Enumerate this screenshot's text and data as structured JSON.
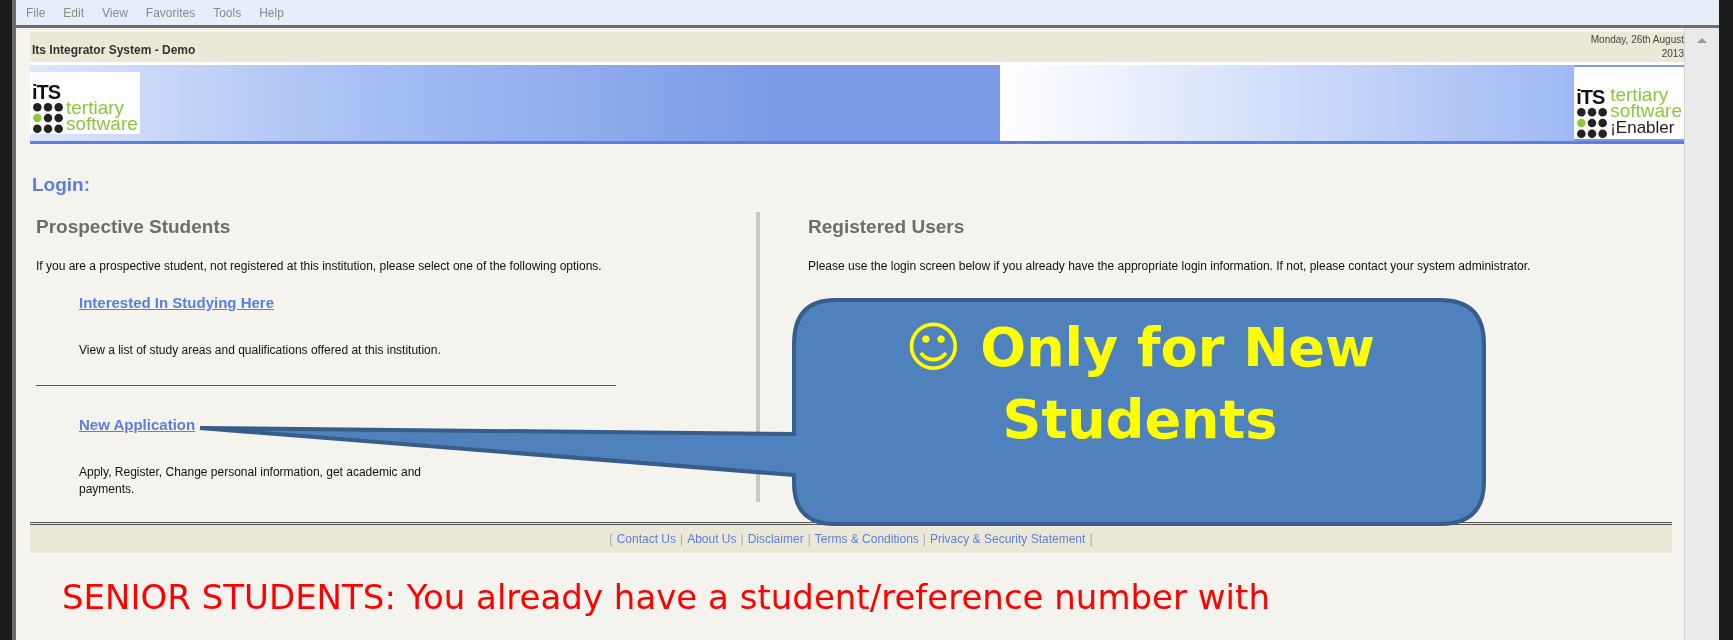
{
  "menu": [
    "File",
    "Edit",
    "View",
    "Favorites",
    "Tools",
    "Help"
  ],
  "header": {
    "title": "Its Integrator System - Demo",
    "date": "Monday, 26th August 2013"
  },
  "banner": {
    "left_logo": {
      "mark": "iTS",
      "lines": [
        "tertiary",
        "software"
      ]
    },
    "right_logo": {
      "mark": "iTS",
      "lines": [
        "tertiary",
        "software"
      ],
      "tagline": "¡Enabler"
    }
  },
  "page_title": "Login:",
  "prospective": {
    "heading": "Prospective Students",
    "intro": "If you are a prospective student, not registered at this institution, please select one of the following options.",
    "options": [
      {
        "link": "Interested In Studying Here",
        "description": "View a list of study areas and qualifications offered at this institution."
      },
      {
        "link": "New Application",
        "description": "Apply, Register, Change personal information, get academic and",
        "description_2": "payments."
      }
    ]
  },
  "registered": {
    "heading": "Registered Users",
    "intro": "Please use the login screen below if you already have the appropriate login information. If not, please contact your system administrator."
  },
  "footer": [
    {
      "kind": "bracket",
      "text": "["
    },
    {
      "kind": "link",
      "text": "Contact Us"
    },
    {
      "kind": "separator",
      "text": "|"
    },
    {
      "kind": "link",
      "text": "About Us"
    },
    {
      "kind": "separator",
      "text": "|"
    },
    {
      "kind": "link",
      "text": "Disclaimer"
    },
    {
      "kind": "separator",
      "text": "|"
    },
    {
      "kind": "link",
      "text": "Terms & Conditions"
    },
    {
      "kind": "separator",
      "text": "|"
    },
    {
      "kind": "link",
      "text": "Privacy & Security Statement"
    },
    {
      "kind": "bracket",
      "text": "]"
    }
  ],
  "note": "SENIOR STUDENTS:  You already have a student/reference number with",
  "callout": {
    "text": "☺ Only for New Students"
  }
}
